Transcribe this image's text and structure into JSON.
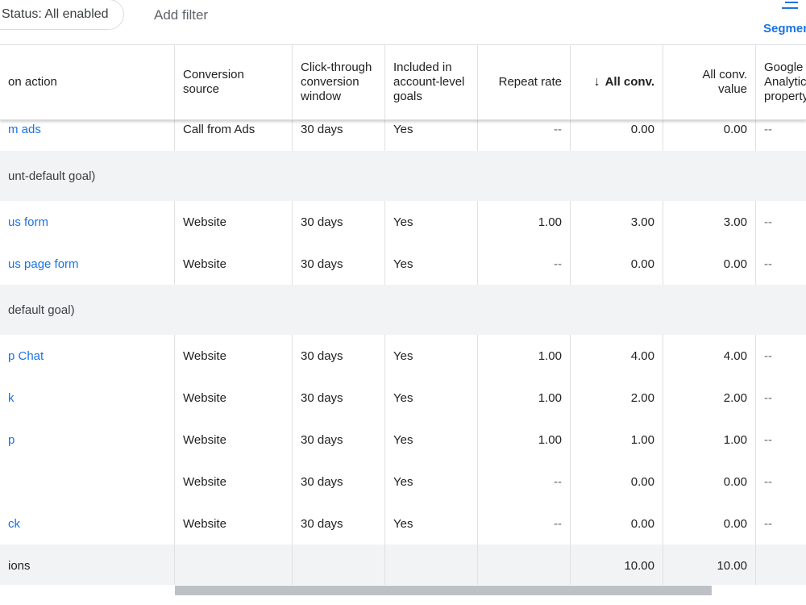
{
  "filters": {
    "status_chip": "Status: All enabled",
    "add_filter": "Add filter"
  },
  "segment": {
    "label": "Segmen",
    "icon": "segment-icon"
  },
  "columns": {
    "action": "on action",
    "source": "Conversion source",
    "window": "Click-through conversion window",
    "included": "Included in account-level goals",
    "repeat": "Repeat rate",
    "allconv": "All conv.",
    "value": "All conv. value",
    "ga": "Google Analytic property"
  },
  "rows": [
    {
      "type": "data",
      "action": "m ads",
      "source": "Call from Ads",
      "window": "30 days",
      "included": "Yes",
      "repeat": "--",
      "allconv": "0.00",
      "value": "0.00",
      "ga": "--"
    },
    {
      "type": "group",
      "label": "unt-default goal)"
    },
    {
      "type": "data",
      "action": "us form",
      "source": "Website",
      "window": "30 days",
      "included": "Yes",
      "repeat": "1.00",
      "allconv": "3.00",
      "value": "3.00",
      "ga": "--"
    },
    {
      "type": "data",
      "action": "us page form",
      "source": "Website",
      "window": "30 days",
      "included": "Yes",
      "repeat": "--",
      "allconv": "0.00",
      "value": "0.00",
      "ga": "--"
    },
    {
      "type": "group",
      "label": "default goal)"
    },
    {
      "type": "data",
      "action": "p Chat",
      "source": "Website",
      "window": "30 days",
      "included": "Yes",
      "repeat": "1.00",
      "allconv": "4.00",
      "value": "4.00",
      "ga": "--"
    },
    {
      "type": "data",
      "action": "k",
      "source": "Website",
      "window": "30 days",
      "included": "Yes",
      "repeat": "1.00",
      "allconv": "2.00",
      "value": "2.00",
      "ga": "--"
    },
    {
      "type": "data",
      "action": "p",
      "source": "Website",
      "window": "30 days",
      "included": "Yes",
      "repeat": "1.00",
      "allconv": "1.00",
      "value": "1.00",
      "ga": "--"
    },
    {
      "type": "data",
      "action": "",
      "source": "Website",
      "window": "30 days",
      "included": "Yes",
      "repeat": "--",
      "allconv": "0.00",
      "value": "0.00",
      "ga": "--"
    },
    {
      "type": "data",
      "action": "ck",
      "source": "Website",
      "window": "30 days",
      "included": "Yes",
      "repeat": "--",
      "allconv": "0.00",
      "value": "0.00",
      "ga": "--"
    }
  ],
  "total": {
    "label": "ions",
    "allconv": "10.00",
    "value": "10.00"
  }
}
